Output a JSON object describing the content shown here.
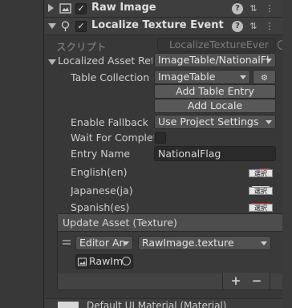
{
  "components": {
    "raw_image": {
      "title": "Raw Image",
      "enabled": true
    },
    "localize": {
      "title": "Localize Texture Event",
      "enabled": true
    }
  },
  "script": {
    "label": "スクリプト",
    "value": "LocalizeTextureEver"
  },
  "localized_asset": {
    "label": "Localized Asset Refe",
    "value": "ImageTable/NationalFl"
  },
  "table_collection": {
    "label": "Table Collection",
    "value": "ImageTable"
  },
  "buttons": {
    "add_table_entry": "Add Table Entry",
    "add_locale": "Add Locale"
  },
  "enable_fallback": {
    "label": "Enable Fallback",
    "value": "Use Project Settings"
  },
  "wait_for_complete": {
    "label": "Wait For Complet",
    "checked": false
  },
  "entry_name": {
    "label": "Entry Name",
    "value": "NationalFlag"
  },
  "locales": [
    {
      "label": "English(en)",
      "select": "選択"
    },
    {
      "label": "Japanese(ja)",
      "select": "選択"
    },
    {
      "label": "Spanish(es)",
      "select": "選択"
    }
  ],
  "event": {
    "title": "Update Asset (Texture)",
    "runtime": "Editor An",
    "function": "RawImage.texture",
    "target": "RawIm"
  },
  "list_controls": {
    "plus": "+",
    "minus": "−"
  },
  "bottom": {
    "title": "Default UI Material (Material)"
  }
}
